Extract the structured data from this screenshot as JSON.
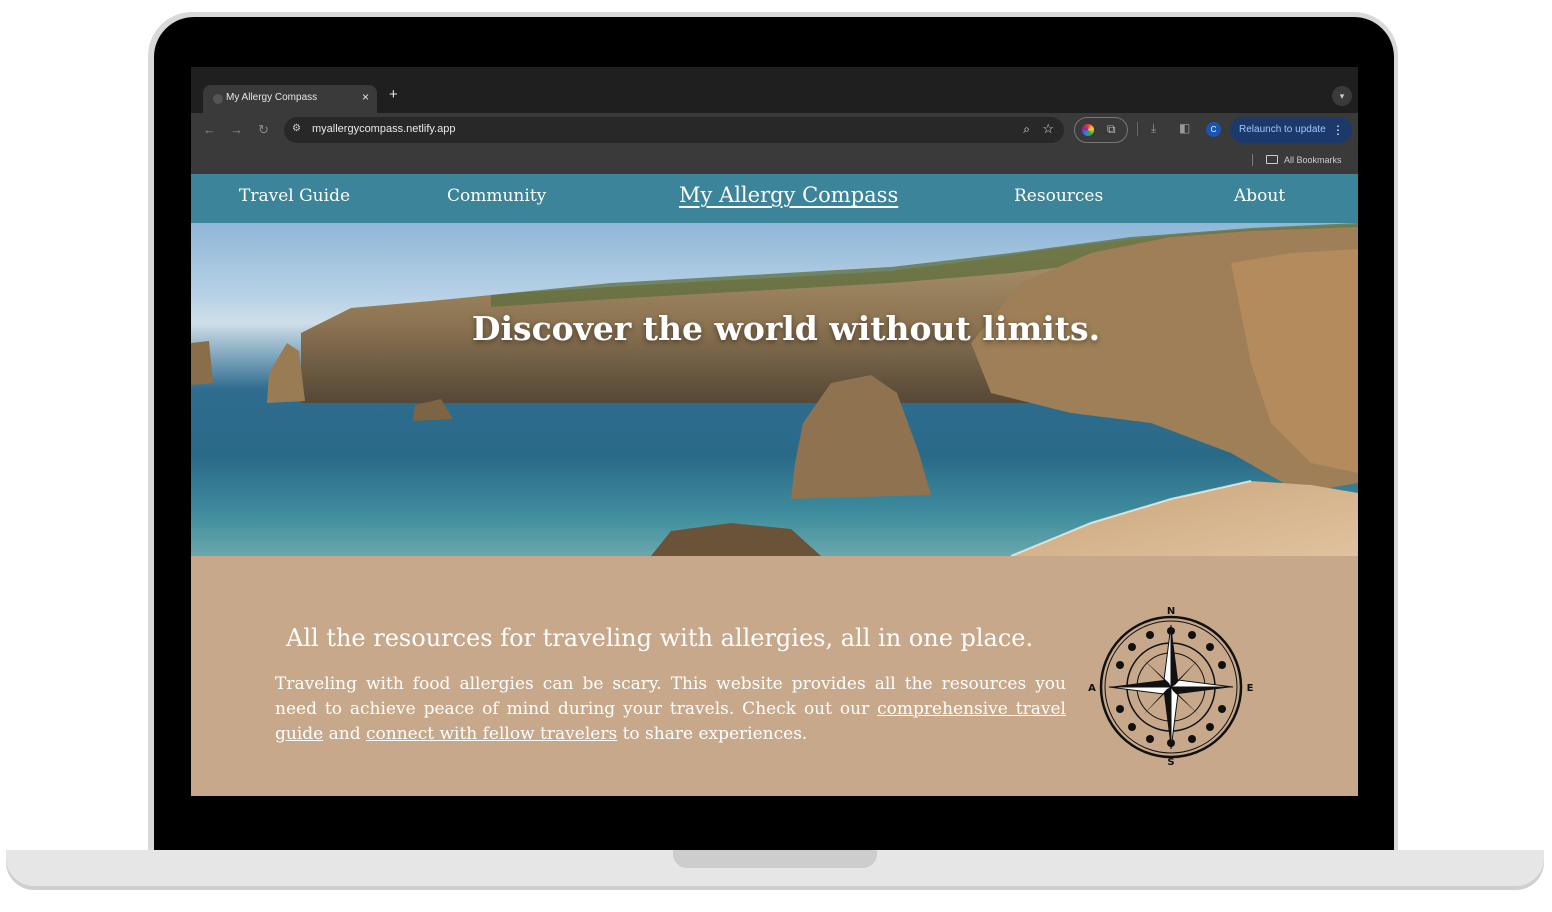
{
  "browser": {
    "tab_title": "My Allergy Compass",
    "tab_close": "×",
    "new_tab": "+",
    "url": "myallergycompass.netlify.app",
    "profile_initial": "C",
    "relaunch_label": "Relaunch to update",
    "bookmarks_label": "All Bookmarks"
  },
  "nav": {
    "travel_guide": "Travel Guide",
    "community": "Community",
    "brand": "My Allergy Compass",
    "resources": "Resources",
    "about": "About"
  },
  "hero": {
    "title": "Discover the world without limits."
  },
  "content": {
    "tagline": "All the resources for traveling with allergies, all in one place.",
    "intro_before": "Traveling with food allergies can be scary. This website provides all the resources you need to achieve peace of mind during your travels. Check out our ",
    "guide_link": "comprehensive travel guide",
    "intro_middle": " and ",
    "community_link": "connect with fellow travelers",
    "intro_after": " to share experiences."
  },
  "compass": {
    "north": "N",
    "south": "S",
    "east": "E",
    "west": "A"
  },
  "colors": {
    "nav_bg": "#3c8499",
    "content_bg": "#c8a88b",
    "relaunch_bg": "#1b3a6b"
  }
}
